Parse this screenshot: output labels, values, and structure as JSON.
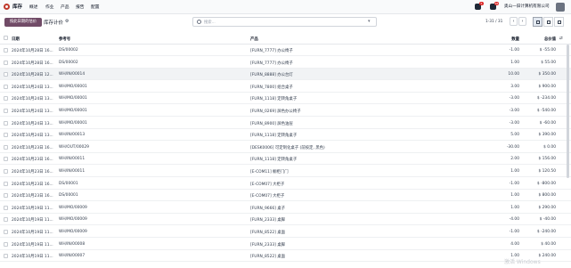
{
  "nav": {
    "app_name": "库存",
    "menu": [
      "概述",
      "作业",
      "产品",
      "报告",
      "配置"
    ],
    "chat_badge": "5",
    "activity_badge": "46",
    "company": "奥山一旧计算机有限公司"
  },
  "control": {
    "export_button": "按此日期的估价",
    "title": "库存计价",
    "search_placeholder": "搜索...",
    "pager": "1-31 / 31"
  },
  "columns": {
    "date": "日期",
    "reference": "参考号",
    "product": "产品",
    "quantity": "数量",
    "value": "总价值"
  },
  "rows": [
    {
      "date": "2024年10月28日 16...",
      "ref": "DS/00002",
      "product": "[FURN_7777] 办公椅子",
      "qty": "-1.00",
      "value": "$ -55.00"
    },
    {
      "date": "2024年10月28日 16...",
      "ref": "DS/00002",
      "product": "[FURN_7777] 办公椅子",
      "qty": "1.00",
      "value": "$ 55.00"
    },
    {
      "date": "2024年10月28日 12...",
      "ref": "WH/IN/00014",
      "product": "[FURN_8888] 办公台灯",
      "qty": "10.00",
      "value": "$ 350.00"
    },
    {
      "date": "2024年10月24日 13...",
      "ref": "WH/MO/00001",
      "product": "[FURN_7800] 组合桌子",
      "qty": "3.00",
      "value": "$ 900.00"
    },
    {
      "date": "2024年10月24日 13...",
      "ref": "WH/MO/00001",
      "product": "[FURN_1118] 定转角桌子",
      "qty": "-3.00",
      "value": "$ -234.00"
    },
    {
      "date": "2024年10月24日 13...",
      "ref": "WH/MO/00001",
      "product": "[FURN_0269] 屏色办公椅子",
      "qty": "-3.00",
      "value": "$ -540.00"
    },
    {
      "date": "2024年10月24日 13...",
      "ref": "WH/MO/00001",
      "product": "[FURN_8900] 屏色油层",
      "qty": "-3.00",
      "value": "$ -60.00"
    },
    {
      "date": "2024年10月24日 13...",
      "ref": "WH/IN/00013",
      "product": "[FURN_1118] 定转角桌子",
      "qty": "5.00",
      "value": "$ 390.00"
    },
    {
      "date": "2024年10月23日 16...",
      "ref": "WH/OUT/00029",
      "product": "[DESK0006] 可定制化桌子 (前按定, 黑色)",
      "qty": "-30.00",
      "value": "$ 0.00"
    },
    {
      "date": "2024年10月23日 16...",
      "ref": "WH/IN/00011",
      "product": "[FURN_1118] 定转角桌子",
      "qty": "2.00",
      "value": "$ 156.00"
    },
    {
      "date": "2024年10月23日 16...",
      "ref": "WH/IN/00011",
      "product": "[E-COM11] 橱柜门门",
      "qty": "1.00",
      "value": "$ 120.50"
    },
    {
      "date": "2024年10月23日 16...",
      "ref": "DS/00001",
      "product": "[E-COM07] 大柜子",
      "qty": "-1.00",
      "value": "$ -800.00"
    },
    {
      "date": "2024年10月23日 16...",
      "ref": "DS/00001",
      "product": "[E-COM07] 大柜子",
      "qty": "1.00",
      "value": "$ 800.00"
    },
    {
      "date": "2024年10月19日 11...",
      "ref": "WH/MO/00009",
      "product": "[FURN_9666] 桌子",
      "qty": "1.00",
      "value": "$ 290.00"
    },
    {
      "date": "2024年10月19日 11...",
      "ref": "WH/MO/00009",
      "product": "[FURN_2333] 桌脚",
      "qty": "-4.00",
      "value": "$ -40.00"
    },
    {
      "date": "2024年10月19日 11...",
      "ref": "WH/MO/00009",
      "product": "[FURN_8522] 桌面",
      "qty": "-1.00",
      "value": "$ -240.00"
    },
    {
      "date": "2024年10月19日 11...",
      "ref": "WH/IN/00008",
      "product": "[FURN_2333] 桌脚",
      "qty": "4.00",
      "value": "$ 40.00"
    },
    {
      "date": "2024年10月19日 11...",
      "ref": "WH/IN/00007",
      "product": "[FURN_8522] 桌面",
      "qty": "1.00",
      "value": "$ 240.00"
    }
  ],
  "watermark": "激活 Windows"
}
